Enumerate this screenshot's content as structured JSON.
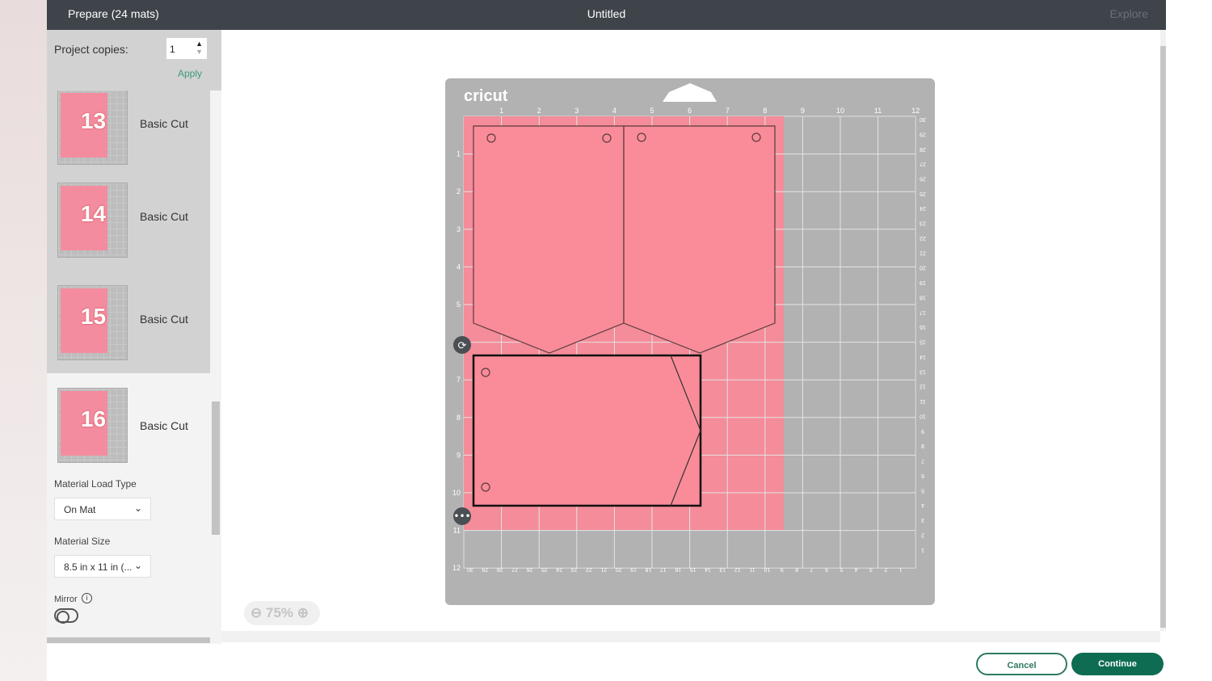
{
  "header": {
    "title": "Prepare (24 mats)",
    "document": "Untitled",
    "right": "Explore"
  },
  "copies": {
    "label": "Project copies:",
    "value": "1",
    "apply": "Apply"
  },
  "mats": [
    {
      "number": "13",
      "label": "Basic Cut"
    },
    {
      "number": "14",
      "label": "Basic Cut"
    },
    {
      "number": "15",
      "label": "Basic Cut"
    },
    {
      "number": "16",
      "label": "Basic Cut",
      "selected": true
    }
  ],
  "settings": {
    "load_type_label": "Material Load Type",
    "load_type_value": "On Mat",
    "size_label": "Material Size",
    "size_value": "8.5 in x 11 in (...",
    "mirror_label": "Mirror",
    "mirror_on": false
  },
  "canvas": {
    "brand": "cricut",
    "top_ruler": [
      "1",
      "2",
      "3",
      "4",
      "5",
      "6",
      "7",
      "8",
      "9",
      "10",
      "11",
      "12"
    ],
    "left_ruler": [
      "1",
      "2",
      "3",
      "4",
      "5",
      "6",
      "7",
      "8",
      "9",
      "10",
      "11",
      "12"
    ],
    "cm_ruler": [
      "30",
      "29",
      "28",
      "27",
      "26",
      "25",
      "24",
      "23",
      "22",
      "21",
      "20",
      "19",
      "18",
      "17",
      "16",
      "15",
      "14",
      "13",
      "12",
      "11",
      "10",
      "9",
      "8",
      "7",
      "6",
      "5",
      "4",
      "3",
      "2",
      "1"
    ],
    "material_color": "#f48c99"
  },
  "zoom": {
    "level": "75%"
  },
  "footer": {
    "cancel": "Cancel",
    "continue": "Continue"
  }
}
